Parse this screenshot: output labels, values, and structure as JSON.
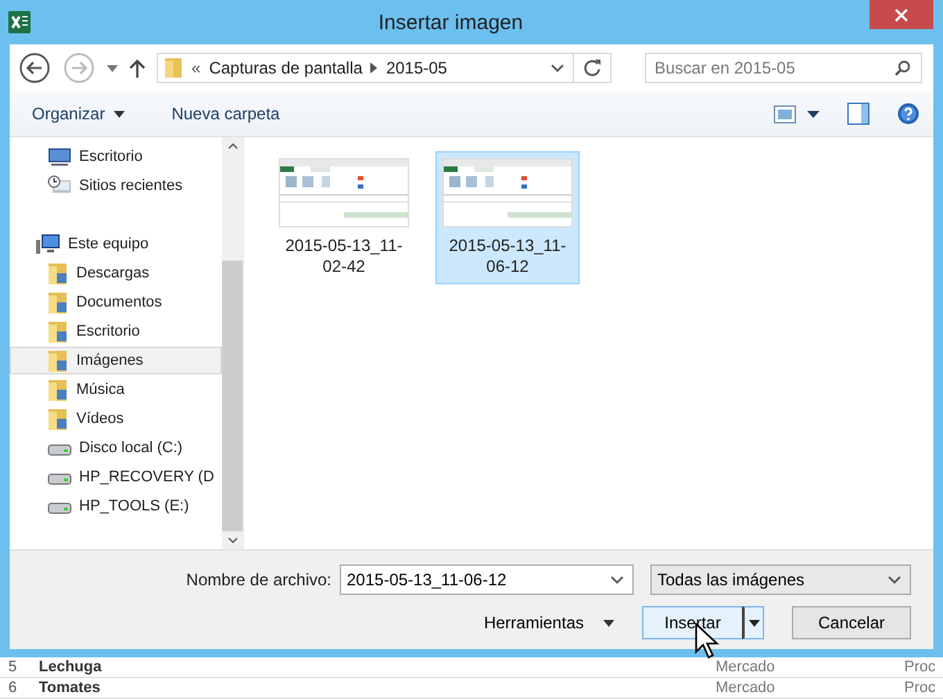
{
  "window": {
    "title": "Insertar imagen"
  },
  "address": {
    "overflow": "«",
    "crumbs": [
      "Capturas de pantalla",
      "2015-05"
    ]
  },
  "search": {
    "placeholder": "Buscar en 2015-05"
  },
  "toolbar": {
    "organize": "Organizar",
    "new_folder": "Nueva carpeta"
  },
  "nav": [
    {
      "label": "Escritorio",
      "kind": "desktop",
      "selected": false
    },
    {
      "label": "Sitios recientes",
      "kind": "recent",
      "selected": false
    },
    {
      "label": "Este equipo",
      "kind": "computer",
      "selected": false,
      "children": [
        {
          "label": "Descargas",
          "kind": "folder",
          "selected": false
        },
        {
          "label": "Documentos",
          "kind": "folder",
          "selected": false
        },
        {
          "label": "Escritorio",
          "kind": "folder",
          "selected": false
        },
        {
          "label": "Imágenes",
          "kind": "folder",
          "selected": true
        },
        {
          "label": "Música",
          "kind": "folder",
          "selected": false
        },
        {
          "label": "Vídeos",
          "kind": "folder",
          "selected": false
        },
        {
          "label": "Disco local (C:)",
          "kind": "drive",
          "selected": false
        },
        {
          "label": "HP_RECOVERY (D",
          "kind": "drive",
          "selected": false
        },
        {
          "label": "HP_TOOLS (E:)",
          "kind": "drive",
          "selected": false
        }
      ]
    }
  ],
  "files": [
    {
      "name": "2015-05-13_11-02-42",
      "kind": "picture",
      "selected": false
    },
    {
      "name": "2015-05-13_11-06-12",
      "kind": "picture",
      "selected": true
    }
  ],
  "filename": {
    "label": "Nombre de archivo:",
    "value": "2015-05-13_11-06-12"
  },
  "filter": {
    "value": "Todas las imágenes"
  },
  "buttons": {
    "tools": "Herramientas",
    "insert": "Insertar",
    "cancel": "Cancelar"
  },
  "sheet_rows": [
    {
      "number": "5",
      "name": "Lechuga",
      "column_3": "Mercado",
      "column_4": "Proc"
    },
    {
      "number": "6",
      "name": "Tomates",
      "column_3": "Mercado",
      "column_4": "Proc"
    }
  ]
}
